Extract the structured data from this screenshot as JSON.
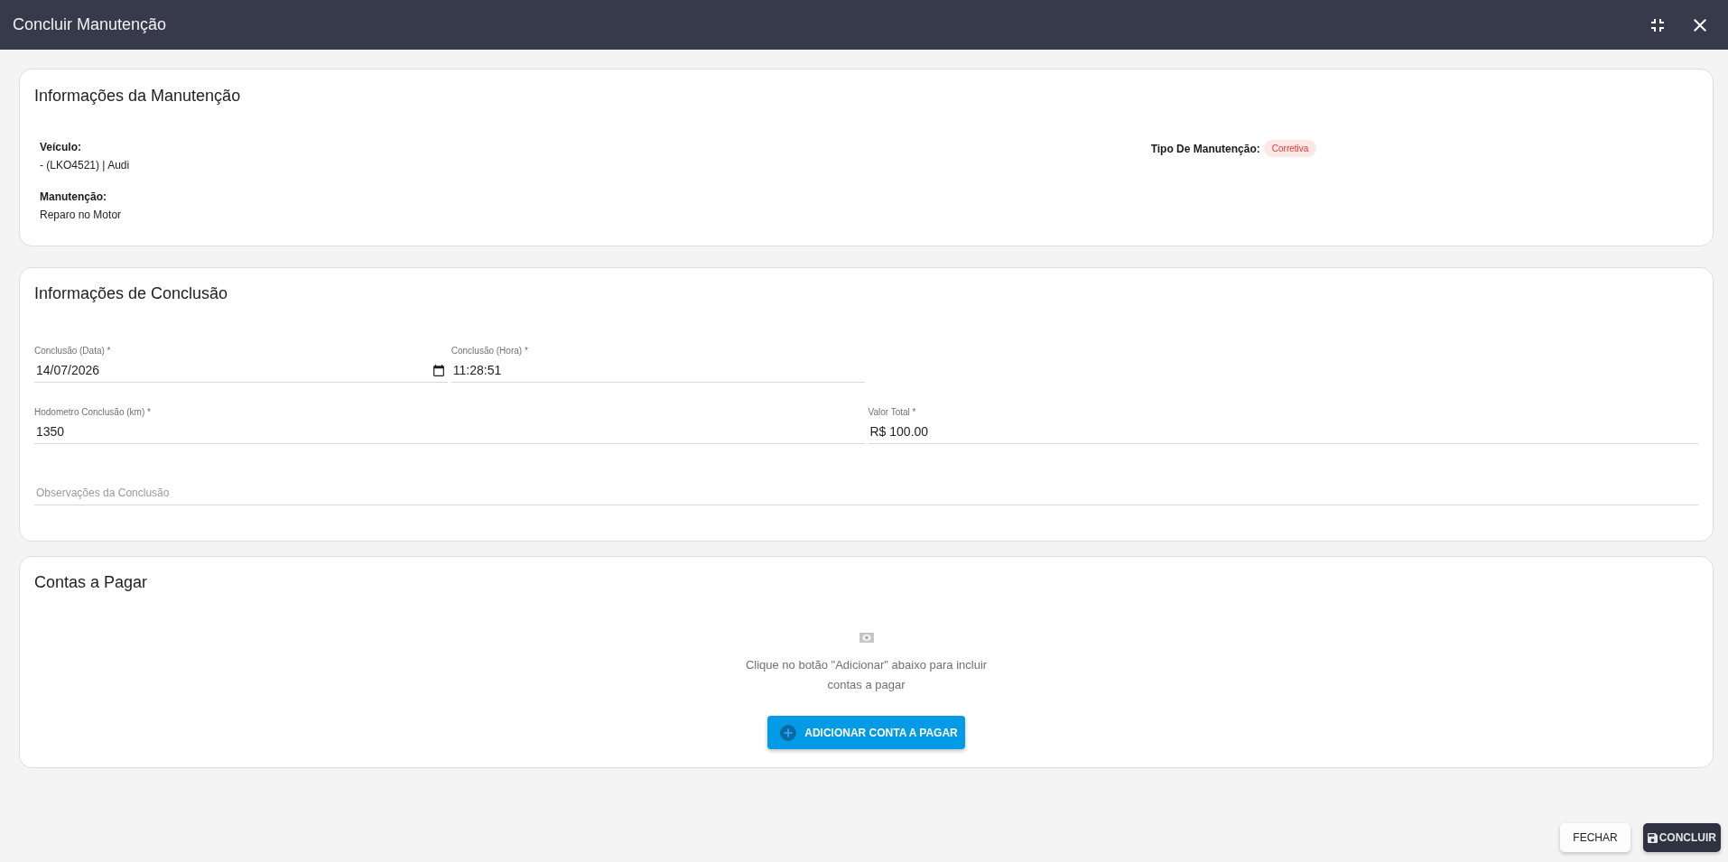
{
  "dialog": {
    "title": "Concluir Manutenção"
  },
  "maintenance_info": {
    "title": "Informações da Manutenção",
    "details": [
      {
        "label": "Veículo:",
        "value": "- (LKO4521) | Audi"
      },
      {
        "label": "Manutenção:",
        "value": "Reparo no Motor"
      }
    ],
    "type": {
      "label": "Tipo De Manutenção:",
      "badge": "Corretiva"
    }
  },
  "completion_info": {
    "title": "Informações de Conclusão",
    "fields": [
      {
        "kind": "date",
        "label": "Conclusão (Data) *",
        "value": "14/07/2026"
      },
      {
        "kind": "time",
        "label": "Conclusão (Hora) *",
        "value": "11:28:51"
      },
      {
        "kind": "text",
        "label": "Hodometro Conclusão (km) *",
        "value": "1350"
      },
      {
        "kind": "text",
        "label": "Valor Total *",
        "value": "R$ 100.00"
      },
      {
        "kind": "notes",
        "placeholder": "Observações da Conclusão"
      }
    ]
  },
  "payables": {
    "title": "Contas a Pagar",
    "empty_message": "Clique no botão \"Adicionar\" abaixo para incluir contas a pagar",
    "add_button": "ADICIONAR CONTA A PAGAR"
  },
  "footer": {
    "buttons": [
      {
        "kind": "secondary",
        "label": "FECHAR"
      },
      {
        "kind": "primary",
        "label": "CONCLUIR"
      }
    ]
  }
}
